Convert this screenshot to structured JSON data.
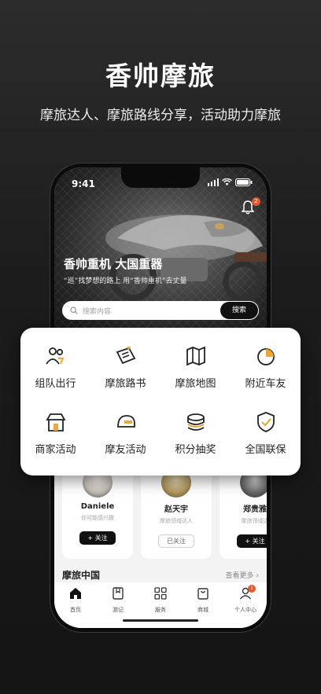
{
  "headline": "香帅摩旅",
  "subline": "摩旅达人、摩旅路线分享，活动助力摩旅",
  "phone": {
    "status_time": "9:41",
    "notification_count": "2",
    "hero": {
      "title": "香帅重机 大国重器",
      "subtitle": "“巡”找梦想的路上 用“香帅重机”去丈量"
    },
    "search": {
      "placeholder": "搜索内容",
      "button": "搜索"
    },
    "users": [
      {
        "name": "Daniele",
        "desc": "你可能感兴趣",
        "follow": "+ 关注",
        "followed": false
      },
      {
        "name": "赵天宇",
        "desc": "摩旅领域达人",
        "follow": "已关注",
        "followed": true
      },
      {
        "name": "郑贵雅",
        "desc": "摩旅领域达",
        "follow": "+ 关注",
        "followed": false
      }
    ],
    "section": {
      "title": "摩旅中国",
      "more": "查看更多"
    },
    "tabs": [
      {
        "label": "首页",
        "icon": "home-icon"
      },
      {
        "label": "游记",
        "icon": "book-icon"
      },
      {
        "label": "服务",
        "icon": "grid-icon"
      },
      {
        "label": "商城",
        "icon": "shop-bag-icon"
      },
      {
        "label": "个人中心",
        "icon": "user-icon",
        "badge": "1"
      }
    ]
  },
  "services": [
    {
      "label": "组队出行",
      "icon": "team-icon"
    },
    {
      "label": "摩旅路书",
      "icon": "route-book-icon"
    },
    {
      "label": "摩旅地图",
      "icon": "map-icon"
    },
    {
      "label": "附近车友",
      "icon": "nearby-icon"
    },
    {
      "label": "商家活动",
      "icon": "merchant-icon"
    },
    {
      "label": "摩友活动",
      "icon": "helmet-icon"
    },
    {
      "label": "积分抽奖",
      "icon": "coins-icon"
    },
    {
      "label": "全国联保",
      "icon": "shield-icon"
    }
  ],
  "colors": {
    "accent": "#e8a93a",
    "badge": "#e2572b",
    "dark": "#111111"
  }
}
